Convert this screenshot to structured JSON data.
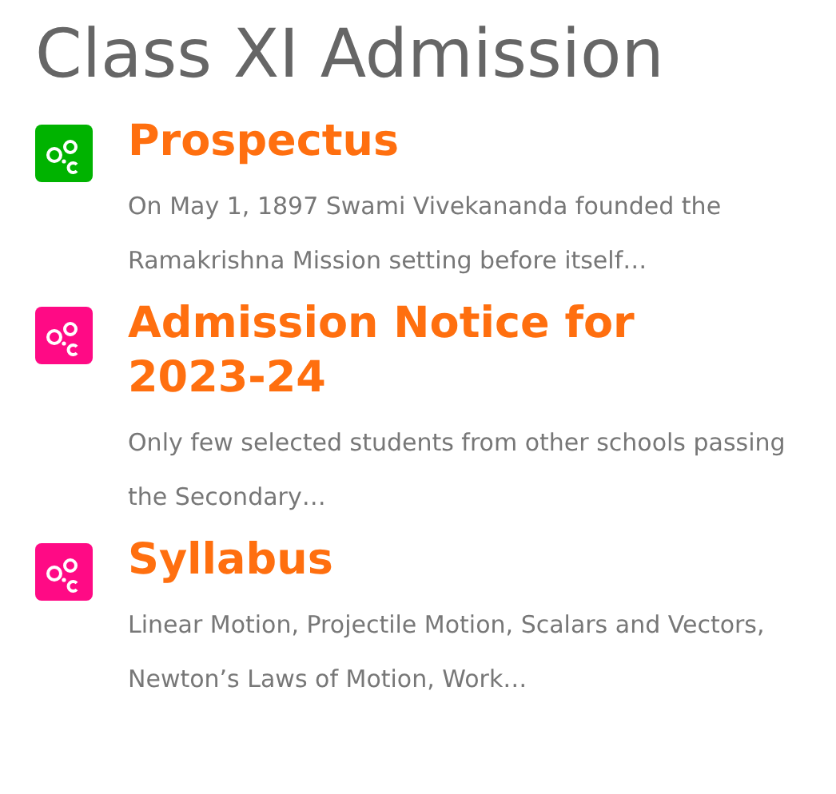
{
  "title": "Class XI Admission",
  "items": [
    {
      "heading": "Prospectus",
      "color": "#00b300",
      "summary": "On May 1, 1897 Swami Vivekananda founded the Ramakrishna Mission setting before itself…"
    },
    {
      "heading": "Admission Notice for 2023-24",
      "color": "#ff0a85",
      "summary": "Only few selected students from other schools passing the Secondary…"
    },
    {
      "heading": "Syllabus",
      "color": "#ff0a85",
      "summary": "Linear Motion, Projectile Motion, Scalars and Vectors, Newton’s Laws of Motion, Work…"
    }
  ]
}
